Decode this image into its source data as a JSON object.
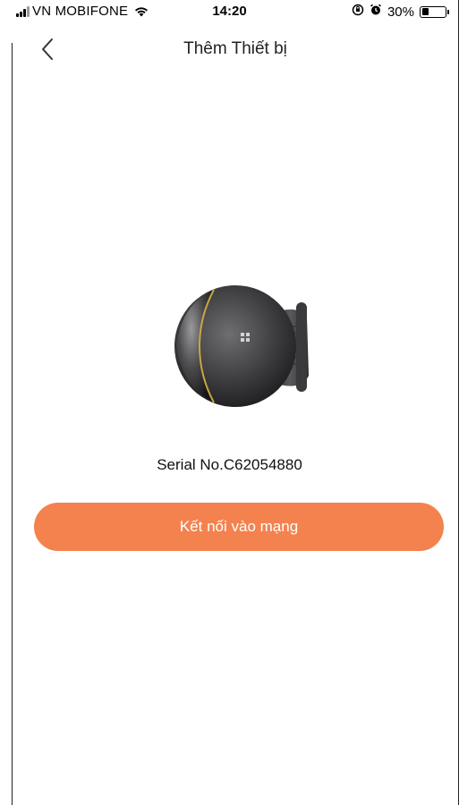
{
  "status_bar": {
    "carrier": "VN MOBIFONE",
    "time": "14:20",
    "battery_percent_label": "30%",
    "battery_level": 0.3
  },
  "header": {
    "title": "Thêm Thiết bị"
  },
  "device": {
    "serial_label": "Serial No.C62054880"
  },
  "actions": {
    "connect_label": "Kết nối vào mạng"
  },
  "colors": {
    "accent": "#f4824e",
    "text": "#111111",
    "background": "#ffffff"
  }
}
